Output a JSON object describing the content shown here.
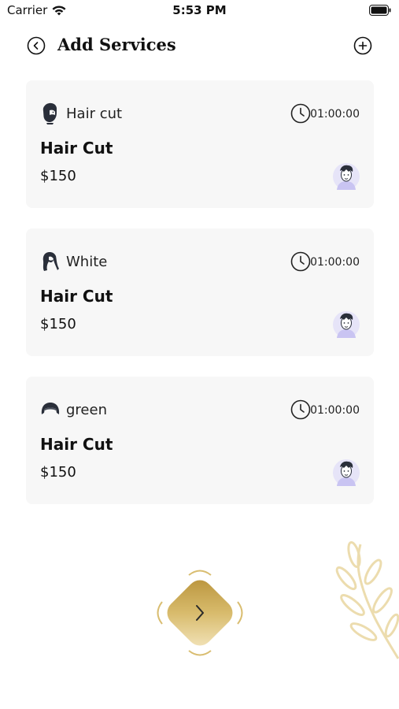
{
  "status_bar": {
    "carrier": "Carrier",
    "time": "5:53 PM"
  },
  "header": {
    "title": "Add Services"
  },
  "services": [
    {
      "category": "Hair cut",
      "icon": "bearded-man-icon",
      "duration": "01:00:00",
      "name": "Hair Cut",
      "price": "$150",
      "avatar": "barber-avatar-icon"
    },
    {
      "category": "White",
      "icon": "long-hair-woman-icon",
      "duration": "01:00:00",
      "name": "Hair Cut",
      "price": "$150",
      "avatar": "barber-avatar-icon"
    },
    {
      "category": "green",
      "icon": "short-hair-icon",
      "duration": "01:00:00",
      "name": "Hair Cut",
      "price": "$150",
      "avatar": "barber-avatar-icon"
    }
  ],
  "colors": {
    "card_bg": "#f7f7f7",
    "accent_gold": "#c9a547",
    "avatar_bg": "#d9d6f5",
    "leaf": "#ecdcae"
  }
}
